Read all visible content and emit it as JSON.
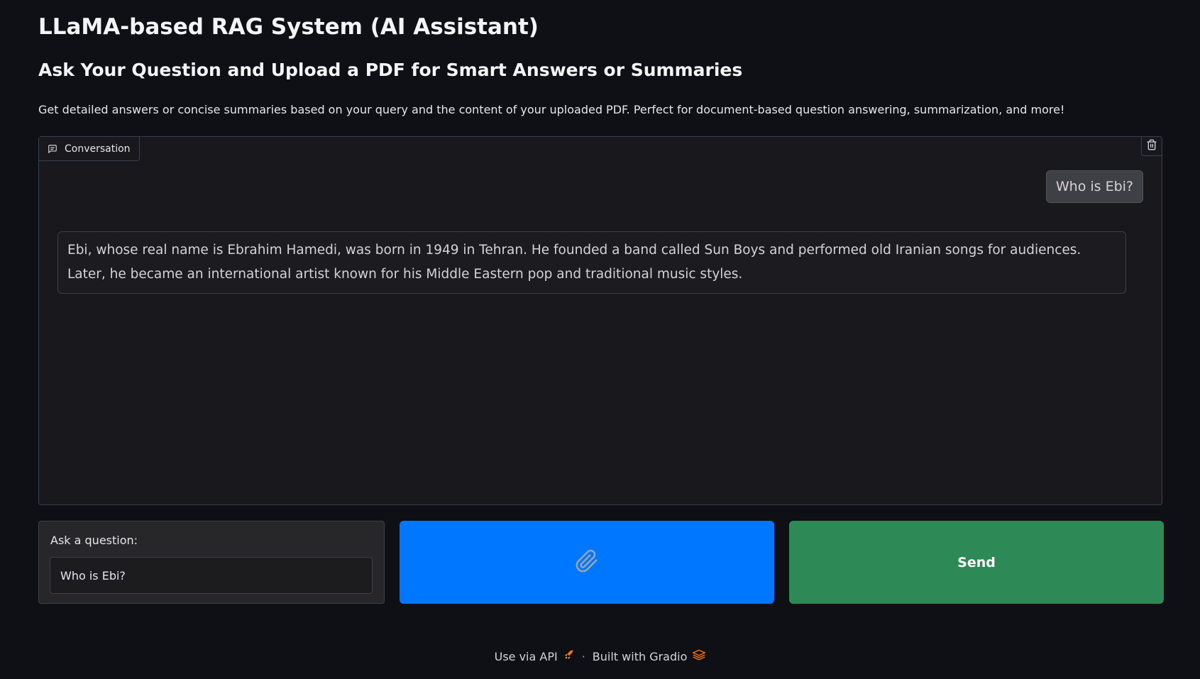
{
  "header": {
    "title": "LLaMA-based RAG System (AI Assistant)",
    "subtitle": "Ask Your Question and Upload a PDF for Smart Answers or Summaries",
    "description": "Get detailed answers or concise summaries based on your query and the content of your uploaded PDF. Perfect for document-based question answering, summarization, and more!"
  },
  "chatbot": {
    "label": "Conversation",
    "label_icon": "chat-bubble-icon",
    "clear_icon": "trash-icon",
    "messages": [
      {
        "role": "user",
        "text": "Who is Ebi?"
      },
      {
        "role": "assistant",
        "text": "Ebi, whose real name is Ebrahim Hamedi, was born in 1949 in Tehran. He founded a band called Sun Boys and performed old Iranian songs for audiences. Later, he became an international artist known for his Middle Eastern pop and traditional music styles."
      }
    ]
  },
  "input": {
    "label": "Ask a question:",
    "value": "Who is Ebi?"
  },
  "buttons": {
    "attach_icon": "paperclip-icon",
    "send_label": "Send"
  },
  "footer": {
    "api_label": "Use via API",
    "api_icon": "rocket-icon",
    "separator": "·",
    "built_label": "Built with Gradio",
    "built_icon": "gradio-logo-icon"
  },
  "colors": {
    "attach_button": "#0077ff",
    "send_button": "#2d8a57",
    "background": "#0f1015"
  }
}
